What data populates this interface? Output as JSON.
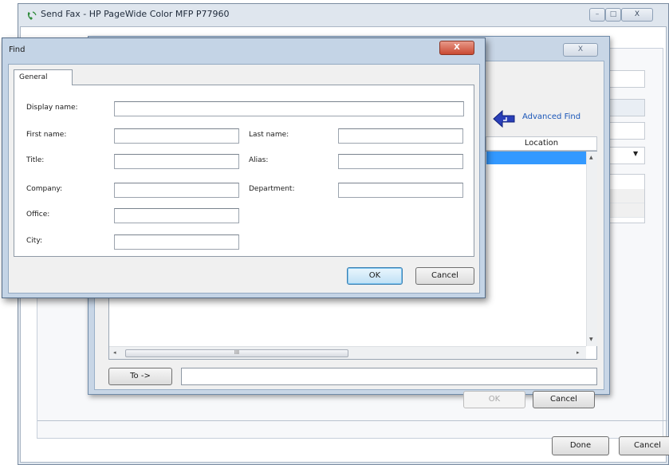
{
  "main_window": {
    "title": "Send Fax - HP PageWide Color MFP P77960",
    "minimize_glyph": "–",
    "maximize_glyph": "□",
    "close_glyph": "X",
    "done_label": "Done",
    "cancel_label": "Cancel"
  },
  "address_book": {
    "close_glyph": "X",
    "advanced_find_label": "Advanced Find",
    "location_header": "Location",
    "to_button_label": "To ->",
    "ok_label": "OK",
    "cancel_label": "Cancel",
    "scroll_left_glyph": "◂",
    "scroll_right_glyph": "▸",
    "scroll_up_glyph": "▲",
    "scroll_down_glyph": "▼",
    "scroll_thumb_grip": "III"
  },
  "find_dialog": {
    "title": "Find",
    "close_glyph": "X",
    "tab_general": "General",
    "fields": {
      "display_name": {
        "label": "Display name:",
        "value": ""
      },
      "first_name": {
        "label": "First name:",
        "value": ""
      },
      "last_name": {
        "label": "Last name:",
        "value": ""
      },
      "title": {
        "label": "Title:",
        "value": ""
      },
      "alias": {
        "label": "Alias:",
        "value": ""
      },
      "company": {
        "label": "Company:",
        "value": ""
      },
      "department": {
        "label": "Department:",
        "value": ""
      },
      "office": {
        "label": "Office:",
        "value": ""
      },
      "city": {
        "label": "City:",
        "value": ""
      }
    },
    "ok_label": "OK",
    "cancel_label": "Cancel"
  },
  "colors": {
    "link_blue": "#1a56b8",
    "selection_blue": "#3399ff",
    "dialog_frame": "#c4d4e6",
    "close_red": "#c94a32"
  }
}
